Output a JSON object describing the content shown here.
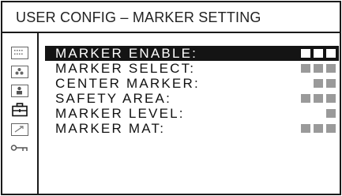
{
  "window": {
    "title": "USER CONFIG – MARKER SETTING"
  },
  "sidebar": {
    "icons": [
      {
        "name": "keypad-icon"
      },
      {
        "name": "color-dots-icon"
      },
      {
        "name": "person-icon"
      },
      {
        "name": "toolbox-icon"
      },
      {
        "name": "arrow-icon"
      },
      {
        "name": "key-icon"
      }
    ]
  },
  "menu": {
    "items": [
      {
        "label": "MARKER ENABLE:",
        "value_blocks": 3,
        "selected": true
      },
      {
        "label": "MARKER SELECT:",
        "value_blocks": 3,
        "selected": false
      },
      {
        "label": "CENTER MARKER:",
        "value_blocks": 2,
        "selected": false
      },
      {
        "label": "SAFETY AREA:",
        "value_blocks": 3,
        "selected": false
      },
      {
        "label": "MARKER LEVEL:",
        "value_blocks": 1,
        "selected": false
      },
      {
        "label": "MARKER MAT:",
        "value_blocks": 3,
        "selected": false
      }
    ]
  },
  "colors": {
    "selection_bg": "#141414",
    "value_block": "#9a9a9a",
    "border": "#1a1a1a"
  }
}
